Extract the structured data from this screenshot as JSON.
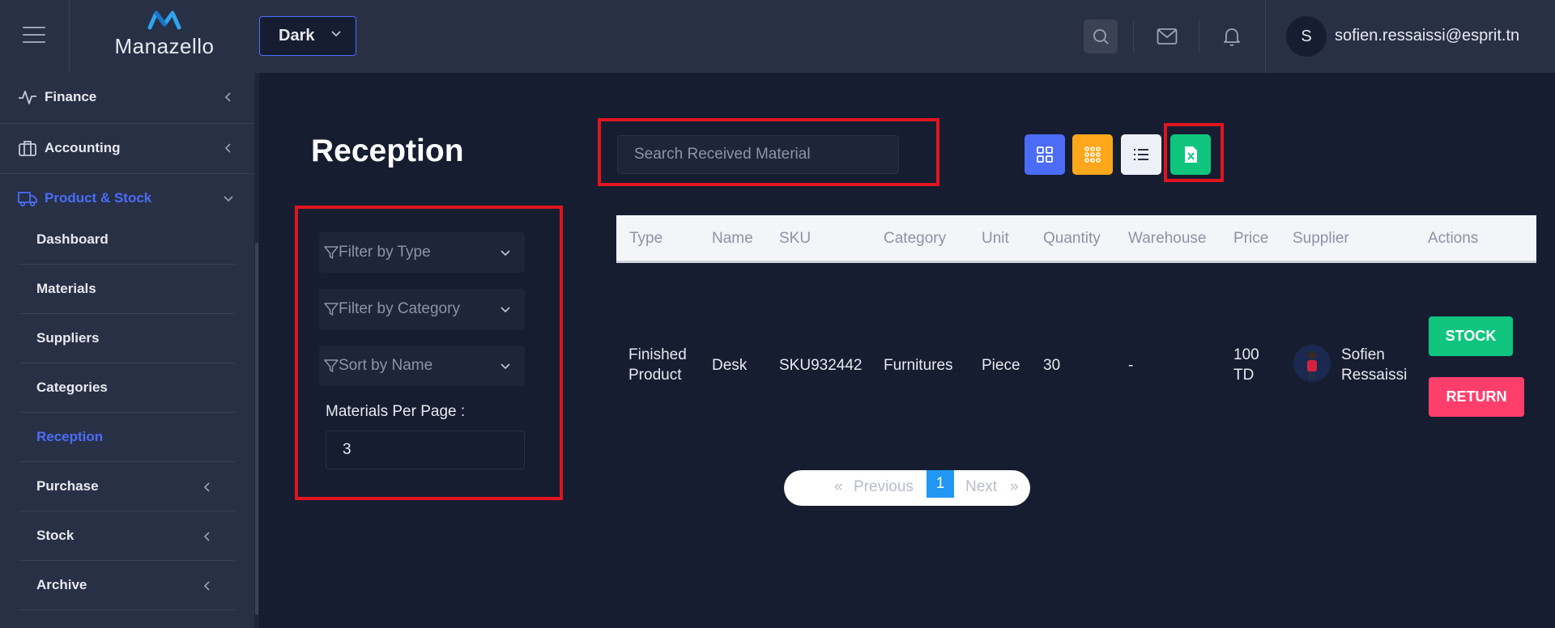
{
  "header": {
    "logo_text": "Manazello",
    "theme_value": "Dark",
    "avatar_initial": "S",
    "user_email": "sofien.ressaissi@esprit.tn"
  },
  "sidebar": {
    "top_items": [
      {
        "label": "Finance",
        "icon": "activity-icon"
      },
      {
        "label": "Accounting",
        "icon": "briefcase-icon"
      },
      {
        "label": "Product & Stock",
        "icon": "truck-icon"
      }
    ],
    "sub_items": [
      {
        "label": "Dashboard"
      },
      {
        "label": "Materials"
      },
      {
        "label": "Suppliers"
      },
      {
        "label": "Categories"
      },
      {
        "label": "Reception"
      },
      {
        "label": "Purchase"
      },
      {
        "label": "Stock"
      },
      {
        "label": "Archive"
      }
    ]
  },
  "main": {
    "title": "Reception",
    "search_placeholder": "Search Received Material",
    "filters": {
      "type": "Filter by Type",
      "category": "Filter by Category",
      "sort": "Sort by Name",
      "per_page_label": "Materials Per Page :",
      "per_page_value": "3"
    },
    "table": {
      "headers": [
        "Type",
        "Name",
        "SKU",
        "Category",
        "Unit",
        "Quantity",
        "Warehouse",
        "Price",
        "Supplier",
        "Actions"
      ],
      "rows": [
        {
          "type_line1": "Finished",
          "type_line2": "Product",
          "name": "Desk",
          "sku": "SKU932442",
          "category": "Furnitures",
          "unit": "Piece",
          "quantity": "30",
          "warehouse": "-",
          "price_line1": "100",
          "price_line2": "TD",
          "supplier_line1": "Sofien",
          "supplier_line2": "Ressaissi",
          "stock_label": "STOCK",
          "return_label": "RETURN"
        }
      ]
    },
    "pagination": {
      "first": "«",
      "previous": "Previous",
      "current": "1",
      "next": "Next",
      "last": "»"
    }
  },
  "colors": {
    "background": "#161d31",
    "panel": "#283046",
    "primary": "#4a6cf7",
    "success": "#0fc57e",
    "warning": "#ffa71a",
    "danger": "#ff3e6c",
    "highlight": "#e0141e"
  }
}
